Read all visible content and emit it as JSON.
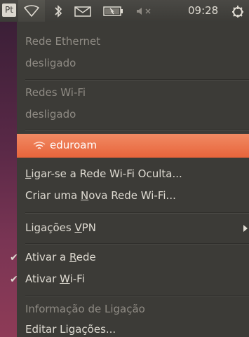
{
  "panel": {
    "keyboard_indicator": "Pt",
    "clock": "09:28",
    "icons": [
      "network-wireless-icon",
      "bluetooth-icon",
      "mail-icon",
      "battery-icon",
      "volume-muted-icon",
      "power-gear-icon"
    ]
  },
  "menu": {
    "ethernet_header": "Rede Ethernet",
    "ethernet_status": "desligado",
    "wifi_header": "Redes Wi-Fi",
    "wifi_status": "desligado",
    "network_name": "eduroam",
    "hidden_prefix": "",
    "hidden_ul": "L",
    "hidden_rest": "igar-se a Rede Wi-Fi Oculta...",
    "create_prefix": "Criar uma ",
    "create_ul": "N",
    "create_rest": "ova Rede Wi-Fi...",
    "vpn_prefix": "Ligações ",
    "vpn_ul": "V",
    "vpn_rest": "PN",
    "enable_network_prefix": "Ativar a ",
    "enable_network_ul": "R",
    "enable_network_rest": "ede",
    "enable_wifi_prefix": "Ativar ",
    "enable_wifi_ul": "W",
    "enable_wifi_rest": "i-Fi",
    "connection_info": "Informação de Ligação",
    "edit_connections": "Editar Ligações...",
    "checkmark": "✔"
  }
}
